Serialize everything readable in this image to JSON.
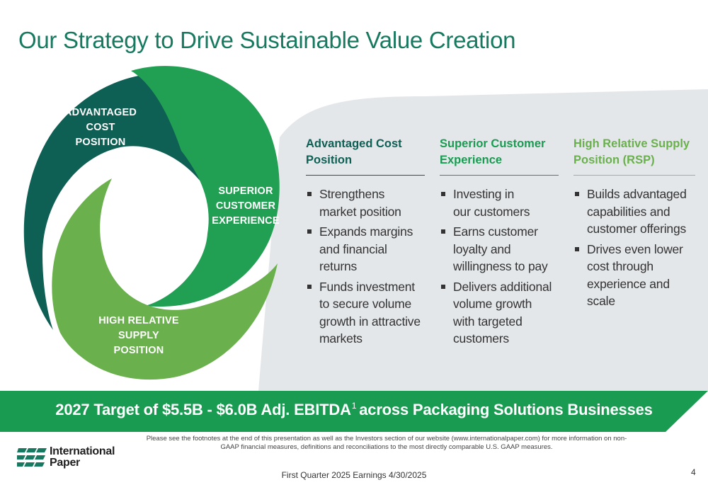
{
  "title": "Our Strategy to Drive Sustainable Value Creation",
  "cycle": {
    "segment_1": [
      "ADVANTAGED",
      "COST",
      "POSITION"
    ],
    "segment_2": [
      "SUPERIOR",
      "CUSTOMER",
      "EXPERIENCE"
    ],
    "segment_3": [
      "HIGH RELATIVE",
      "SUPPLY",
      "POSITION"
    ]
  },
  "columns": [
    {
      "title_lines": [
        "Advantaged Cost",
        "Position"
      ],
      "color": "#0e5f54",
      "bullets": [
        [
          "Strengthens",
          "market position"
        ],
        [
          "Expands margins",
          "and financial",
          "returns"
        ],
        [
          "Funds investment",
          "to secure volume",
          "growth in attractive",
          "markets"
        ]
      ]
    },
    {
      "title_lines": [
        "Superior Customer",
        "Experience"
      ],
      "color": "#1a9b52",
      "bullets": [
        [
          "Investing in",
          "our customers"
        ],
        [
          "Earns customer",
          "loyalty and",
          "willingness to pay"
        ],
        [
          "Delivers additional",
          "volume growth",
          "with targeted",
          "customers"
        ]
      ]
    },
    {
      "title_lines": [
        "High Relative Supply",
        "Position (RSP)"
      ],
      "color": "#6ab04c",
      "bullets": [
        [
          "Builds advantaged",
          "capabilities and",
          "customer offerings"
        ],
        [
          "Drives even lower",
          "cost through",
          "experience and",
          "scale"
        ]
      ]
    }
  ],
  "banner": {
    "text_before": "2027 Target of $5.5B - $6.0B Adj. EBITDA",
    "superscript": "1",
    "text_after": "across Packaging Solutions Businesses"
  },
  "footnote": "Please see the footnotes at the end of this presentation as well as the Investors section of our website (www.internationalpaper.com) for more information on non-GAAP financial measures, definitions and reconciliations to the most directly comparable U.S. GAAP measures.",
  "logo": {
    "icon": "international-paper-logo-icon",
    "line_1": "International",
    "line_2": "Paper"
  },
  "footer": "First Quarter 2025 Earnings 4/30/2025",
  "page_number": "4",
  "colors": {
    "dark_green": "#0e5f54",
    "green": "#1a9b52",
    "light_green": "#6ab04c",
    "panel_gray": "#e4e7ea",
    "title_green": "#17795f"
  }
}
